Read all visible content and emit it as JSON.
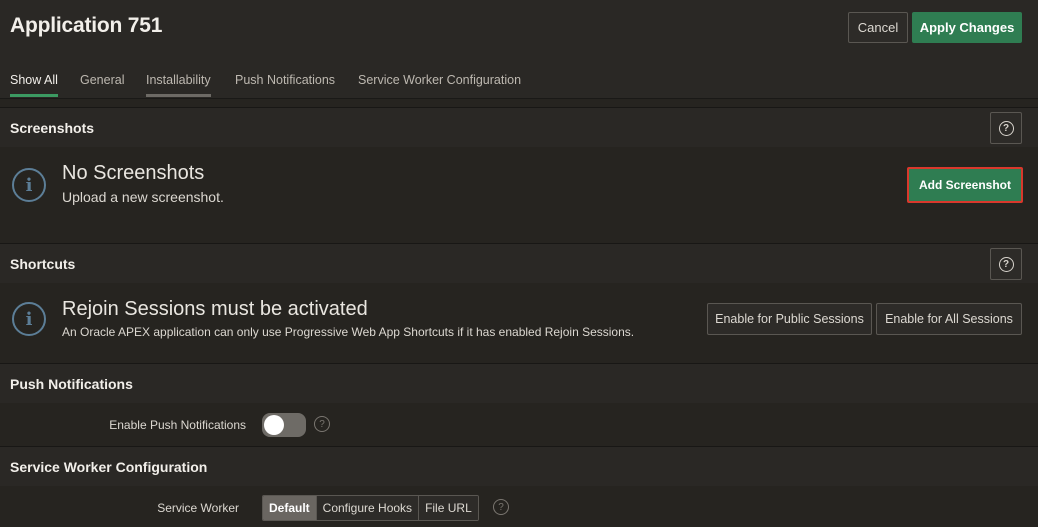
{
  "app": {
    "title": "Application 751"
  },
  "toolbar": {
    "cancel_label": "Cancel",
    "apply_label": "Apply Changes"
  },
  "tabs": [
    {
      "label": "Show All"
    },
    {
      "label": "General"
    },
    {
      "label": "Installability"
    },
    {
      "label": "Push Notifications"
    },
    {
      "label": "Service Worker Configuration"
    }
  ],
  "screenshots": {
    "title": "Screenshots",
    "message_title": "No Screenshots",
    "message_sub": "Upload a new screenshot.",
    "add_label": "Add Screenshot"
  },
  "shortcuts": {
    "title": "Shortcuts",
    "message_title": "Rejoin Sessions must be activated",
    "message_sub": "An Oracle APEX application can only use Progressive Web App Shortcuts if it has enabled Rejoin Sessions.",
    "public_label": "Enable for Public Sessions",
    "all_label": "Enable for All Sessions"
  },
  "push": {
    "title": "Push Notifications",
    "field_label": "Enable Push Notifications",
    "enabled": false
  },
  "service_worker": {
    "title": "Service Worker Configuration",
    "field_label": "Service Worker",
    "options": [
      "Default",
      "Configure Hooks",
      "File URL"
    ],
    "selected": "Default"
  },
  "icons": {
    "help": "help-icon",
    "info": "info-icon"
  },
  "colors": {
    "accent_green": "#2f7d52",
    "highlight_red": "#d9382c",
    "info_blue": "#5c7e97"
  }
}
